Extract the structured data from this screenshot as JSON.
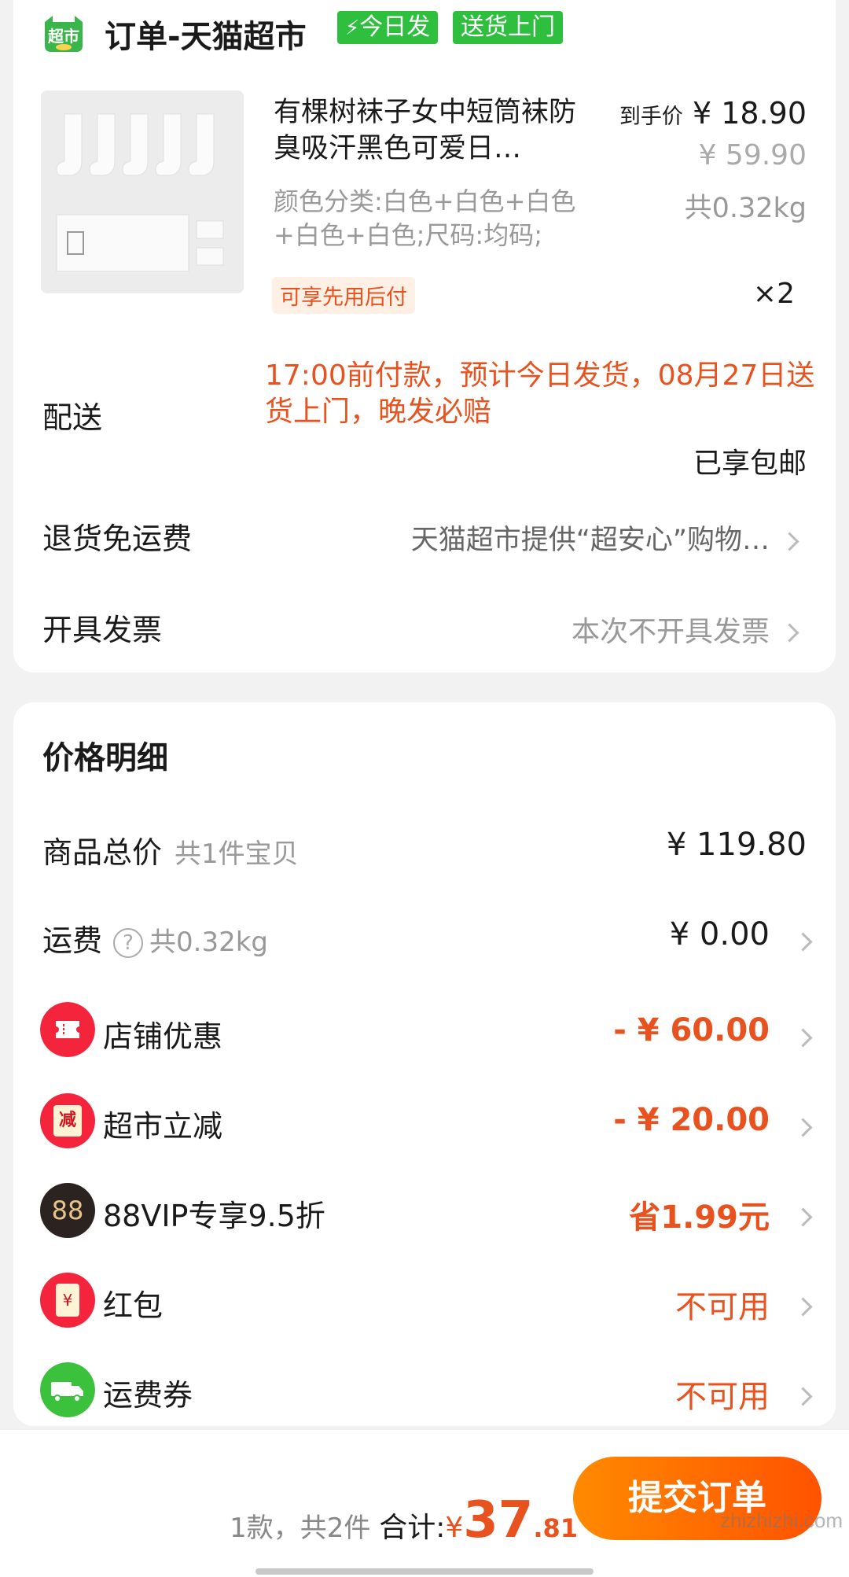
{
  "shop": {
    "logo_text": "超市",
    "name": "订单-天猫超市",
    "tags": [
      "今日发",
      "送货上门"
    ]
  },
  "product": {
    "title": "有棵树袜子女中短筒袜防臭吸汗黑色可爱日…",
    "sku": "颜色分类:白色+白色+白色+白色+白色;尺码:均码;",
    "pay_later": "可享先用后付",
    "deal_label": "到手价",
    "deal_price": "¥ 18.90",
    "original_price": "¥ 59.90",
    "weight": "共0.32kg",
    "quantity": "×2"
  },
  "delivery": {
    "label": "配送",
    "text": "17:00前付款，预计今日发货，08月27日送货上门，晚发必赔",
    "free_shipping": "已享包邮"
  },
  "return_shipping": {
    "label": "退货免运费",
    "value": "天猫超市提供“超安心”购物…"
  },
  "invoice": {
    "label": "开具发票",
    "value": "本次不开具发票"
  },
  "price_detail": {
    "title": "价格明细",
    "rows": [
      {
        "label": "商品总价",
        "sub": "共1件宝贝",
        "value": "¥ 119.80"
      },
      {
        "label": "运费",
        "sub": "共0.32kg",
        "value": "¥ 0.00"
      },
      {
        "label": "店铺优惠",
        "value": "- ¥ 60.00",
        "icon": "coupon-icon"
      },
      {
        "label": "超市立减",
        "value": "- ¥ 20.00",
        "icon": "reduce-icon",
        "icon_text": "减"
      },
      {
        "label": "88VIP专享9.5折",
        "value": "省1.99元",
        "icon": "vip88-icon",
        "icon_text": "88"
      },
      {
        "label": "红包",
        "value": "不可用",
        "icon": "red-packet-icon",
        "icon_text": "¥"
      },
      {
        "label": "运费券",
        "value": "不可用",
        "icon": "truck-icon"
      }
    ]
  },
  "footer": {
    "summary": "1款，共2件",
    "total_label": "合计:",
    "currency": "¥",
    "total_int": "37",
    "total_dec": ".81",
    "submit_label": "提交订单",
    "watermark": "zhizhizhi.com"
  },
  "colors": {
    "accent": "#e8521f",
    "green_tag": "#2fbf3f",
    "button_start": "#ff8a00",
    "button_end": "#ff5200"
  }
}
